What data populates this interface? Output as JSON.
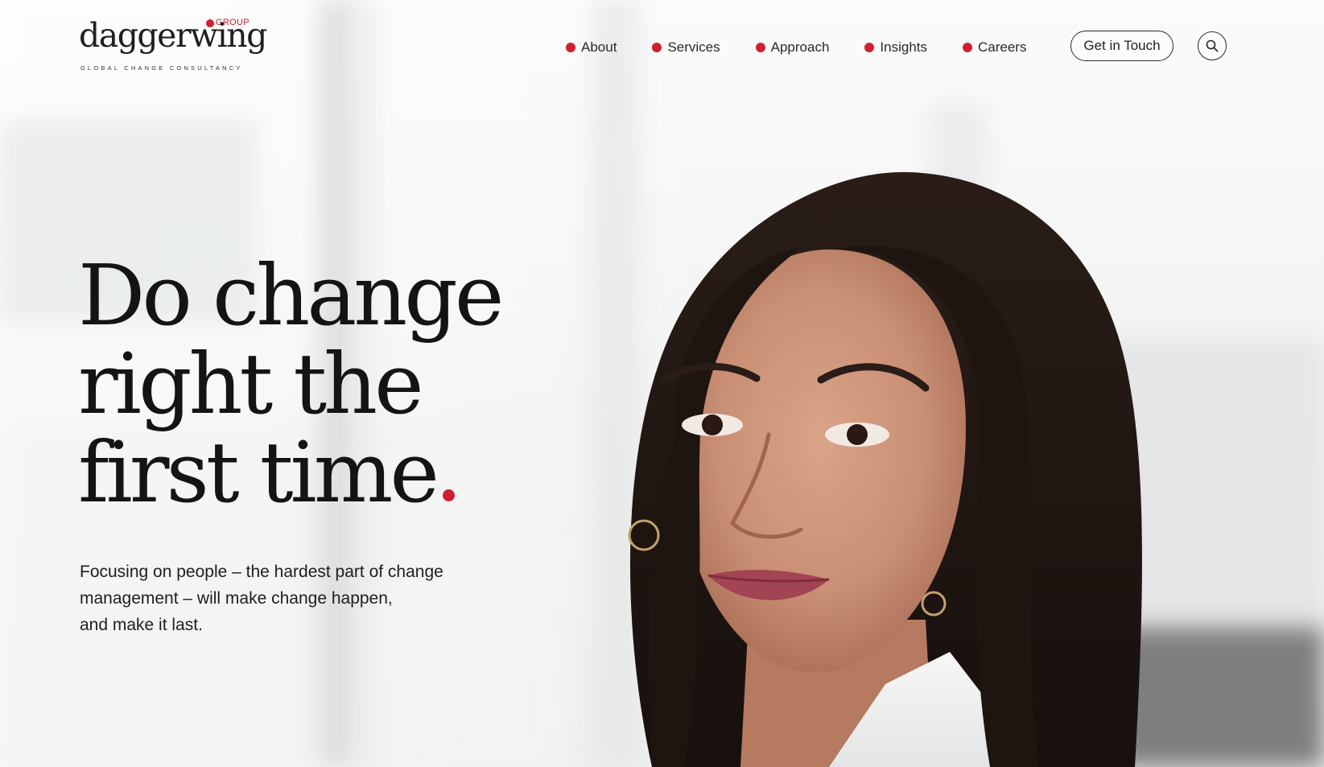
{
  "brand": {
    "name": "daggerwing",
    "group_label": "GROUP",
    "tagline": "GLOBAL CHANGE CONSULTANCY",
    "accent_color": "#d0202e"
  },
  "nav": {
    "items": [
      {
        "label": "About"
      },
      {
        "label": "Services"
      },
      {
        "label": "Approach"
      },
      {
        "label": "Insights"
      },
      {
        "label": "Careers"
      }
    ],
    "cta_label": "Get in Touch",
    "search_icon": "search-icon"
  },
  "hero": {
    "title_lines": [
      "Do change",
      "right the",
      "first time"
    ],
    "subtitle_lines": [
      "Focusing on people – the hardest part of change",
      "management – will make change happen,",
      "and make it last."
    ]
  }
}
